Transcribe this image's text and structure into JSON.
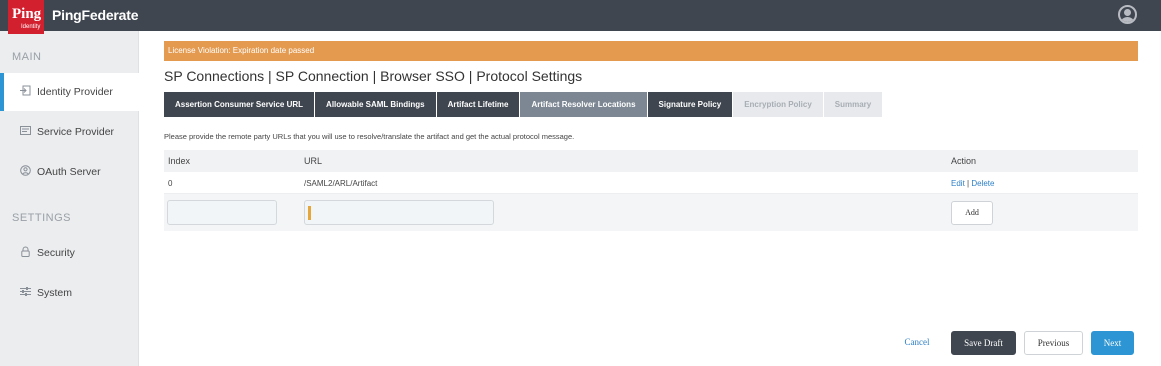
{
  "header": {
    "logo_text": "Ping",
    "logo_subtext": "Identity",
    "product_name": "PingFederate",
    "user_icon": "user-avatar-icon"
  },
  "sidebar": {
    "main_title": "MAIN",
    "settings_title": "SETTINGS",
    "items": [
      {
        "label": "Identity Provider",
        "icon": "identity-provider-icon",
        "active": true
      },
      {
        "label": "Service Provider",
        "icon": "service-provider-icon",
        "active": false
      },
      {
        "label": "OAuth Server",
        "icon": "oauth-icon",
        "active": false
      },
      {
        "label": "Security",
        "icon": "lock-icon",
        "active": false
      },
      {
        "label": "System",
        "icon": "sliders-icon",
        "active": false
      }
    ]
  },
  "alert": "License Violation: Expiration date passed",
  "title": "SP Connections | SP Connection | Browser SSO | Protocol Settings",
  "tabs": [
    {
      "label": "Assertion Consumer Service URL",
      "state": "normal"
    },
    {
      "label": "Allowable SAML Bindings",
      "state": "normal"
    },
    {
      "label": "Artifact Lifetime",
      "state": "normal"
    },
    {
      "label": "Artifact Resolver Locations",
      "state": "current"
    },
    {
      "label": "Signature Policy",
      "state": "normal"
    },
    {
      "label": "Encryption Policy",
      "state": "disabled"
    },
    {
      "label": "Summary",
      "state": "disabled"
    }
  ],
  "description": "Please provide the remote party URLs that you will use to resolve/translate the artifact and get the actual protocol message.",
  "table": {
    "headers": {
      "index": "Index",
      "url": "URL",
      "action": "Action"
    },
    "rows": [
      {
        "index": "0",
        "url": "/SAML2/ARL/Artifact",
        "edit": "Edit",
        "separator": "|",
        "delete": "Delete"
      }
    ],
    "new_row": {
      "index_value": "",
      "url_value": "",
      "add_label": "Add"
    }
  },
  "footer": {
    "cancel": "Cancel",
    "save_draft": "Save Draft",
    "previous": "Previous",
    "next": "Next"
  },
  "colors": {
    "header_bg": "#3f4650",
    "accent": "#2d95d3",
    "alert": "#e49a4f",
    "logo_red": "#d3202f"
  }
}
